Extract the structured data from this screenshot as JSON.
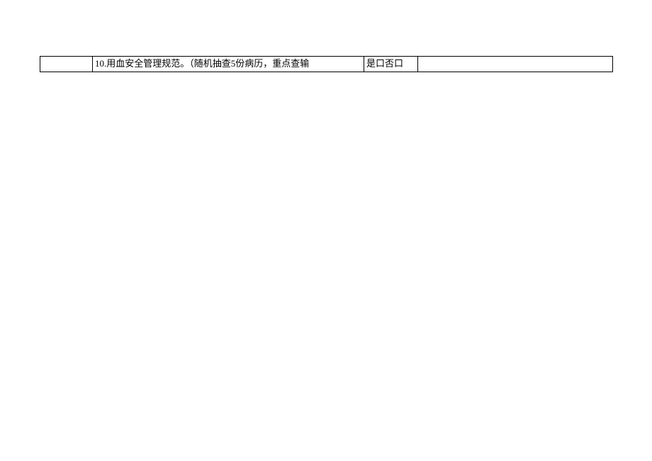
{
  "table": {
    "rows": [
      {
        "c1": "",
        "c2": "10.用血安全管理规范。（随机抽查5份病历，重点查输",
        "c3": "是口否口",
        "c4": ""
      }
    ]
  }
}
